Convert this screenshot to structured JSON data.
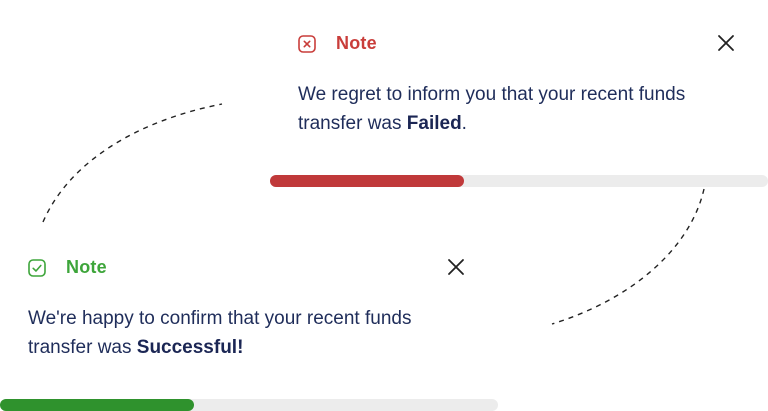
{
  "colors": {
    "failed_accent": "#c93d3a",
    "failed_bar": "#c0393a",
    "success_accent": "#3da53a",
    "success_bar": "#2f922d",
    "text": "#1f2d5a",
    "track": "#ececec"
  },
  "failed_toast": {
    "icon": "x-circle-icon",
    "title": "Note",
    "message_prefix": "We regret to inform you that your recent funds transfer was ",
    "status_word": "Failed",
    "message_suffix": ".",
    "close_icon": "close-icon",
    "progress": 0.39
  },
  "success_toast": {
    "icon": "check-square-icon",
    "title": "Note",
    "message_prefix": "We're happy to confirm that your recent funds transfer was ",
    "status_word": "Successful!",
    "message_suffix": "",
    "close_icon": "close-icon",
    "progress": 0.39
  }
}
